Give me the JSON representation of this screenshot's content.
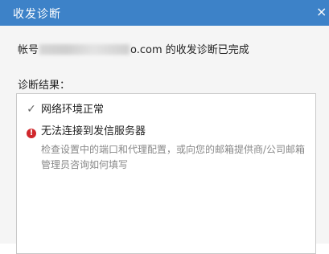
{
  "dialog": {
    "title": "收发诊断",
    "close_glyph": "×"
  },
  "account": {
    "prefix": "帐号",
    "suffix": "o.com 的收发诊断已完成"
  },
  "results": {
    "label": "诊断结果：",
    "items": [
      {
        "icon": "check-icon",
        "text": "网络环境正常"
      },
      {
        "icon": "error-icon",
        "text": "无法连接到发信服务器"
      }
    ],
    "hint": "检查设置中的端口和代理配置，或向您的邮箱提供商/公司邮箱管理员咨询如何填写"
  },
  "colors": {
    "titlebar": "#3d82c8",
    "error": "#d0272c",
    "hint_text": "#888888"
  }
}
